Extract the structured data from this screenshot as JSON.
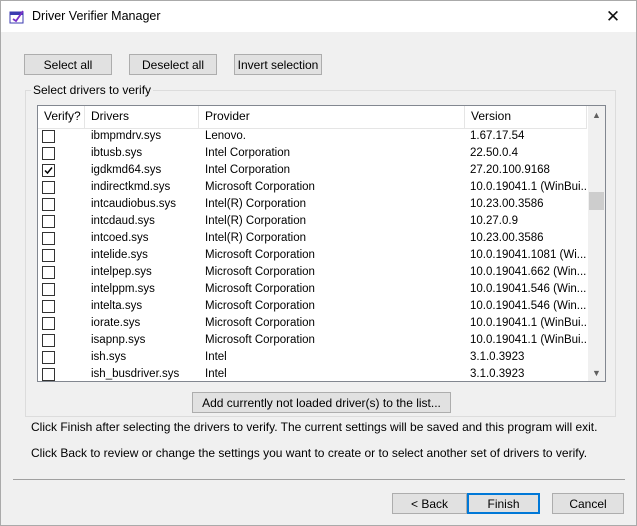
{
  "window": {
    "title": "Driver Verifier Manager",
    "icon": "driver-verifier-app-icon",
    "close_glyph": "✕"
  },
  "toolbar": {
    "select_all": "Select all",
    "deselect_all": "Deselect all",
    "invert_selection": "Invert selection"
  },
  "group": {
    "label": "Select drivers to verify"
  },
  "table": {
    "columns": [
      "Verify?",
      "Drivers",
      "Provider",
      "Version"
    ],
    "rows": [
      {
        "checked": false,
        "driver": "ibmpmdrv.sys",
        "provider": "Lenovo.",
        "version": "1.67.17.54"
      },
      {
        "checked": false,
        "driver": "ibtusb.sys",
        "provider": "Intel Corporation",
        "version": "22.50.0.4"
      },
      {
        "checked": true,
        "driver": "igdkmd64.sys",
        "provider": "Intel Corporation",
        "version": "27.20.100.9168"
      },
      {
        "checked": false,
        "driver": "indirectkmd.sys",
        "provider": "Microsoft Corporation",
        "version": "10.0.19041.1 (WinBui..."
      },
      {
        "checked": false,
        "driver": "intcaudiobus.sys",
        "provider": "Intel(R) Corporation",
        "version": "10.23.00.3586"
      },
      {
        "checked": false,
        "driver": "intcdaud.sys",
        "provider": "Intel(R) Corporation",
        "version": "10.27.0.9"
      },
      {
        "checked": false,
        "driver": "intcoed.sys",
        "provider": "Intel(R) Corporation",
        "version": "10.23.00.3586"
      },
      {
        "checked": false,
        "driver": "intelide.sys",
        "provider": "Microsoft Corporation",
        "version": "10.0.19041.1081 (Wi..."
      },
      {
        "checked": false,
        "driver": "intelpep.sys",
        "provider": "Microsoft Corporation",
        "version": "10.0.19041.662 (Win..."
      },
      {
        "checked": false,
        "driver": "intelppm.sys",
        "provider": "Microsoft Corporation",
        "version": "10.0.19041.546 (Win..."
      },
      {
        "checked": false,
        "driver": "intelta.sys",
        "provider": "Microsoft Corporation",
        "version": "10.0.19041.546 (Win..."
      },
      {
        "checked": false,
        "driver": "iorate.sys",
        "provider": "Microsoft Corporation",
        "version": "10.0.19041.1 (WinBui..."
      },
      {
        "checked": false,
        "driver": "isapnp.sys",
        "provider": "Microsoft Corporation",
        "version": "10.0.19041.1 (WinBui..."
      },
      {
        "checked": false,
        "driver": "ish.sys",
        "provider": "Intel",
        "version": "3.1.0.3923"
      },
      {
        "checked": false,
        "driver": "ish_busdriver.sys",
        "provider": "Intel",
        "version": "3.1.0.3923"
      }
    ]
  },
  "add_button": "Add currently not loaded driver(s) to the list...",
  "info": {
    "line1": "Click Finish after selecting the drivers to verify. The current settings will be saved and this program will exit.",
    "line2": "Click Back to review or change the settings you want to create or to select another set of drivers to verify."
  },
  "footer": {
    "back": "< Back",
    "finish": "Finish",
    "cancel": "Cancel"
  },
  "colors": {
    "dialog_bg": "#f0f0f0",
    "button_bg": "#e1e1e1",
    "default_button_border": "#0078d7"
  }
}
